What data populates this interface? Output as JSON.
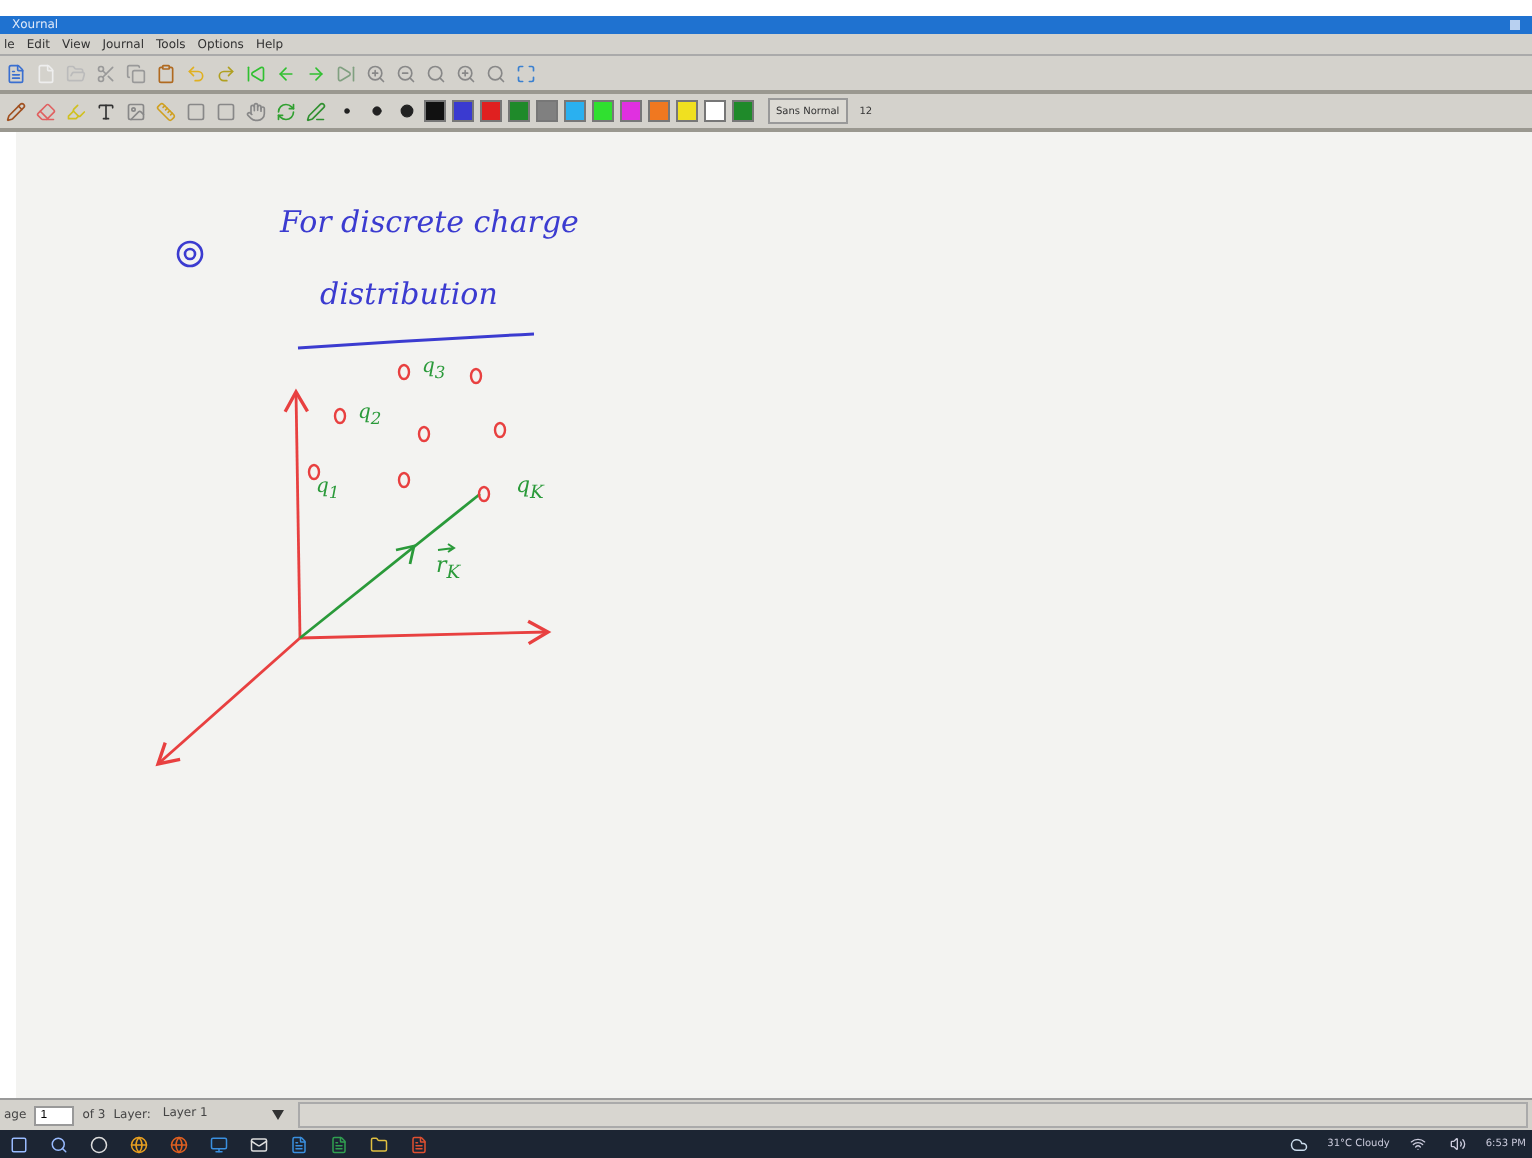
{
  "window": {
    "title": "Xournal"
  },
  "menu": [
    "le",
    "Edit",
    "View",
    "Journal",
    "Tools",
    "Options",
    "Help"
  ],
  "palette": [
    {
      "color": "#111111"
    },
    {
      "color": "#3a3ad0"
    },
    {
      "color": "#e02020"
    },
    {
      "color": "#1f8a2a"
    },
    {
      "color": "#808080"
    },
    {
      "color": "#2ab0f0"
    },
    {
      "color": "#30e030"
    },
    {
      "color": "#e030e0"
    },
    {
      "color": "#f07820"
    },
    {
      "color": "#f0e020"
    },
    {
      "color": "#ffffff"
    },
    {
      "color": "#1f8a2a"
    }
  ],
  "font_button": {
    "name": "Sans Normal",
    "size": "12"
  },
  "canvas": {
    "texts": [
      {
        "text": "For discrete charge",
        "color": "#3b3bd0"
      },
      {
        "text": "distribution",
        "color": "#3b3bd0"
      },
      {
        "text": "q$_{3}$",
        "color": "#2a9a3a"
      },
      {
        "text": "q$_{2}$",
        "color": "#2a9a3a"
      },
      {
        "text": "q$_{1}$",
        "color": "#2a9a3a"
      },
      {
        "text": "q$_{K}$",
        "color": "#2a9a3a"
      },
      {
        "text": "r$_{K}$",
        "color": "#2a9a3a"
      }
    ]
  },
  "status_bar": {
    "page_label": "age",
    "page": "1",
    "page_count": "of 3",
    "layer_label": "Layer:",
    "layer": "Layer 1"
  },
  "taskbar": {
    "weather": "31°C Cloudy",
    "time": "6:53 PM"
  }
}
